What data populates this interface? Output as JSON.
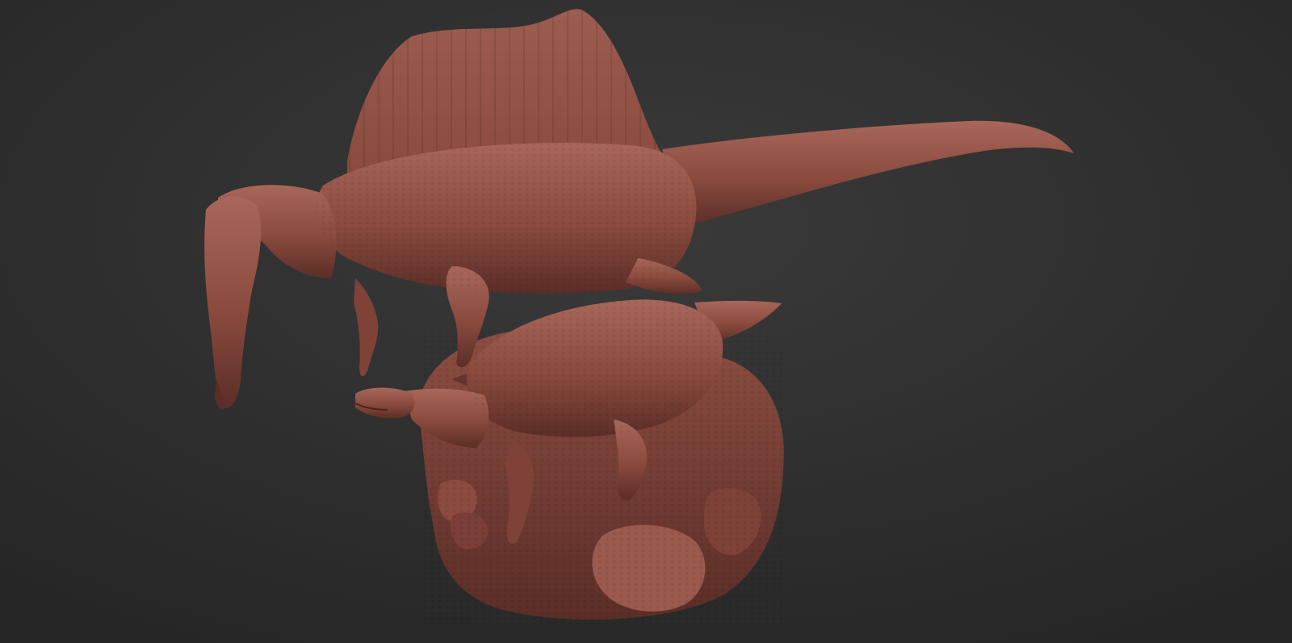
{
  "scene": {
    "background_color": "#2b2b2b",
    "background_highlight": "#3a3a3a",
    "clay_color": "#8a4a3e",
    "clay_highlight": "#a8675a",
    "clay_shadow": "#4a2520",
    "subjects": [
      "spinosaurus-sculpt",
      "ornithopod-sculpt",
      "rock-base"
    ]
  }
}
